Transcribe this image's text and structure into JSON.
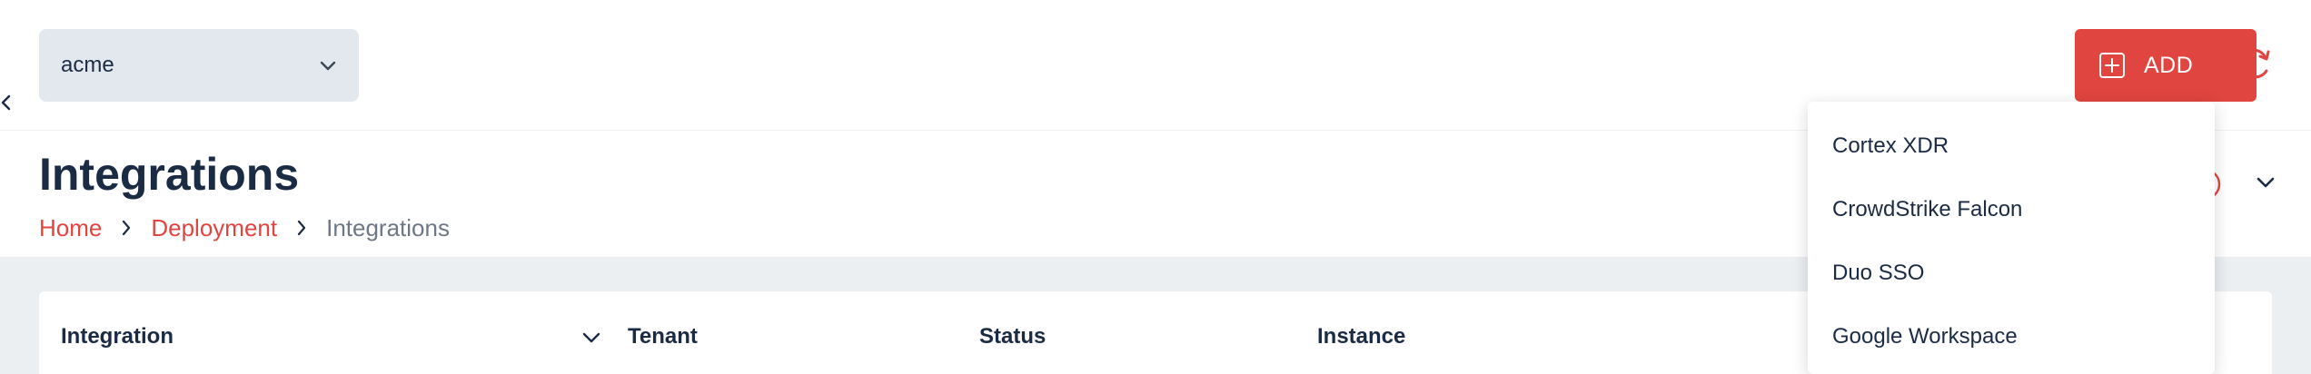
{
  "topbar": {
    "tenant_select": {
      "value": "acme"
    },
    "add_button": {
      "label": "ADD"
    }
  },
  "header": {
    "title": "Integrations",
    "breadcrumb": [
      "Home",
      "Deployment",
      "Integrations"
    ]
  },
  "table": {
    "columns": [
      "Integration",
      "Tenant",
      "Status",
      "Instance"
    ]
  },
  "add_menu": {
    "items": [
      "Cortex XDR",
      "CrowdStrike Falcon",
      "Duo SSO",
      "Google Workspace"
    ]
  },
  "colors": {
    "accent": "#e0453f",
    "text_primary": "#1b2b44",
    "select_bg": "#e3e8ee",
    "content_bg": "#ebeff2",
    "breadcrumb_current": "#6d7785"
  },
  "icons": {
    "collapse": "chevron-left-icon",
    "select": "chevron-down-icon",
    "add": "plus-square-icon",
    "refresh": "refresh-icon",
    "breadcrumb_separator": "chevron-right-icon",
    "header_toggle": "chevron-down-icon",
    "column_sort": "chevron-down-icon"
  }
}
